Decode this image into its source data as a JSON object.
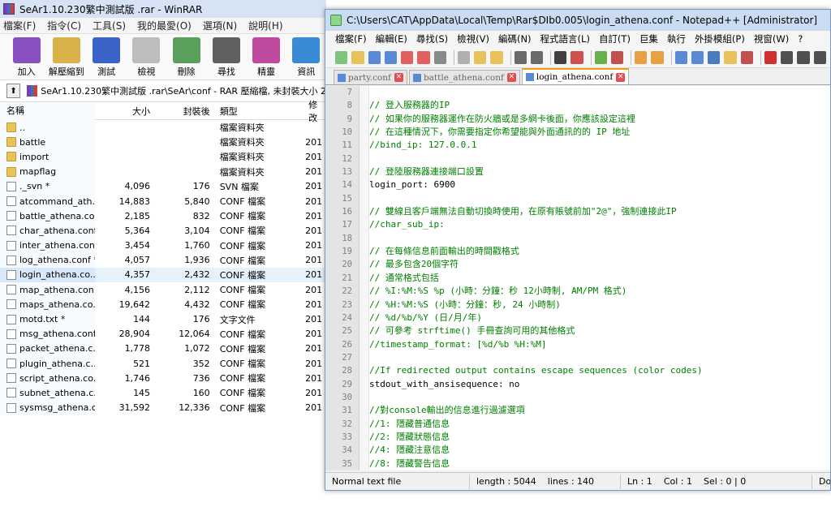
{
  "winrar": {
    "title": "SeAr1.10.230繁中測試版 .rar - WinRAR",
    "menu": [
      "檔案(F)",
      "指令(C)",
      "工具(S)",
      "我的最愛(O)",
      "選項(N)",
      "說明(H)"
    ],
    "toolbar": [
      {
        "label": "加入",
        "icon": "add-books-icon",
        "color": "#8a4fc0"
      },
      {
        "label": "解壓縮到",
        "icon": "extract-folder-icon",
        "color": "#d9b24a"
      },
      {
        "label": "測試",
        "icon": "test-book-icon",
        "color": "#3a62c8"
      },
      {
        "label": "檢視",
        "icon": "view-glasses-icon",
        "color": "#bdbdbd"
      },
      {
        "label": "刪除",
        "icon": "delete-bin-icon",
        "color": "#5aa05a"
      },
      {
        "label": "尋找",
        "icon": "find-binoculars-icon",
        "color": "#606060"
      },
      {
        "label": "精靈",
        "icon": "wizard-icon",
        "color": "#c04aa0"
      },
      {
        "label": "資訊",
        "icon": "info-icon",
        "color": "#3a8ad6"
      }
    ],
    "path": "SeAr1.10.230繁中測試版 .rar\\SeAr\\conf - RAR 壓縮檔, 未封裝大小 2",
    "columns": {
      "name": "名稱",
      "size": "大小",
      "packed": "封裝後",
      "type": "類型",
      "modified": "修改"
    },
    "files": [
      {
        "name": "..",
        "size": "",
        "packed": "",
        "type": "檔案資料夾",
        "mod": "",
        "kind": "folder"
      },
      {
        "name": "battle",
        "size": "",
        "packed": "",
        "type": "檔案資料夾",
        "mod": "201",
        "kind": "folder"
      },
      {
        "name": "import",
        "size": "",
        "packed": "",
        "type": "檔案資料夾",
        "mod": "201",
        "kind": "folder"
      },
      {
        "name": "mapflag",
        "size": "",
        "packed": "",
        "type": "檔案資料夾",
        "mod": "201",
        "kind": "folder"
      },
      {
        "name": "._svn *",
        "size": "4,096",
        "packed": "176",
        "type": "SVN 檔案",
        "mod": "201",
        "kind": "file"
      },
      {
        "name": "atcommand_ath...",
        "size": "14,883",
        "packed": "5,840",
        "type": "CONF 檔案",
        "mod": "201",
        "kind": "file"
      },
      {
        "name": "battle_athena.co...",
        "size": "2,185",
        "packed": "832",
        "type": "CONF 檔案",
        "mod": "201",
        "kind": "file"
      },
      {
        "name": "char_athena.conf *",
        "size": "5,364",
        "packed": "3,104",
        "type": "CONF 檔案",
        "mod": "201",
        "kind": "file"
      },
      {
        "name": "inter_athena.con...",
        "size": "3,454",
        "packed": "1,760",
        "type": "CONF 檔案",
        "mod": "201",
        "kind": "file"
      },
      {
        "name": "log_athena.conf *",
        "size": "4,057",
        "packed": "1,936",
        "type": "CONF 檔案",
        "mod": "201",
        "kind": "file"
      },
      {
        "name": "login_athena.co...",
        "size": "4,357",
        "packed": "2,432",
        "type": "CONF 檔案",
        "mod": "201",
        "kind": "file",
        "selected": true
      },
      {
        "name": "map_athena.con...",
        "size": "4,156",
        "packed": "2,112",
        "type": "CONF 檔案",
        "mod": "201",
        "kind": "file"
      },
      {
        "name": "maps_athena.co...",
        "size": "19,642",
        "packed": "4,432",
        "type": "CONF 檔案",
        "mod": "201",
        "kind": "file"
      },
      {
        "name": "motd.txt *",
        "size": "144",
        "packed": "176",
        "type": "文字文件",
        "mod": "201",
        "kind": "file"
      },
      {
        "name": "msg_athena.conf *",
        "size": "28,904",
        "packed": "12,064",
        "type": "CONF 檔案",
        "mod": "201",
        "kind": "file"
      },
      {
        "name": "packet_athena.c...",
        "size": "1,778",
        "packed": "1,072",
        "type": "CONF 檔案",
        "mod": "201",
        "kind": "file"
      },
      {
        "name": "plugin_athena.c...",
        "size": "521",
        "packed": "352",
        "type": "CONF 檔案",
        "mod": "201",
        "kind": "file"
      },
      {
        "name": "script_athena.co...",
        "size": "1,746",
        "packed": "736",
        "type": "CONF 檔案",
        "mod": "201",
        "kind": "file"
      },
      {
        "name": "subnet_athena.c...",
        "size": "145",
        "packed": "160",
        "type": "CONF 檔案",
        "mod": "201",
        "kind": "file"
      },
      {
        "name": "sysmsg_athena.c...",
        "size": "31,592",
        "packed": "12,336",
        "type": "CONF 檔案",
        "mod": "201",
        "kind": "file"
      }
    ]
  },
  "npp": {
    "title": "C:\\Users\\CAT\\AppData\\Local\\Temp\\Rar$DIb0.005\\login_athena.conf - Notepad++ [Administrator]",
    "menu": [
      "檔案(F)",
      "編輯(E)",
      "尋找(S)",
      "檢視(V)",
      "編碼(N)",
      "程式語言(L)",
      "自訂(T)",
      "巨集",
      "執行",
      "外掛模組(P)",
      "視窗(W)",
      "?"
    ],
    "toolbar_colors": [
      "#7dc47d",
      "#e8c25a",
      "#5a8ad6",
      "#5a8ad6",
      "#e06060",
      "#e06060",
      "#8a8a8a",
      "sep",
      "#b0b0b0",
      "#e8c25a",
      "#e8c25a",
      "sep",
      "#6a6a6a",
      "#6a6a6a",
      "sep",
      "#404040",
      "#d05050",
      "sep",
      "#6ab04a",
      "#c05050",
      "sep",
      "#e8a040",
      "#e8a040",
      "sep",
      "#5a8ad6",
      "#5a8ad6",
      "#4a7ac0",
      "#e8c25a",
      "#c05050",
      "sep",
      "#d03030",
      "#505050",
      "#505050",
      "#505050"
    ],
    "tabs": [
      {
        "label": "party.conf",
        "active": false
      },
      {
        "label": "battle_athena.conf",
        "active": false
      },
      {
        "label": "login_athena.conf",
        "active": true
      }
    ],
    "lines": [
      {
        "n": "7",
        "text": "",
        "kind": "plain"
      },
      {
        "n": "8",
        "text": "// 登入服務器的IP",
        "kind": "comment"
      },
      {
        "n": "9",
        "text": "// 如果你的服務器運作在防火牆或是多網卡後面，你應該設定這裡",
        "kind": "comment"
      },
      {
        "n": "10",
        "text": "// 在這種情況下，你需要指定你希望能與外面通訊的的 IP 地址",
        "kind": "comment"
      },
      {
        "n": "11",
        "text": "//bind_ip: 127.0.0.1",
        "kind": "comment"
      },
      {
        "n": "12",
        "text": "",
        "kind": "plain"
      },
      {
        "n": "13",
        "text": "// 登陸服務器連接端口設置",
        "kind": "comment"
      },
      {
        "n": "14",
        "text": "login_port: 6900",
        "kind": "plain"
      },
      {
        "n": "15",
        "text": "",
        "kind": "plain"
      },
      {
        "n": "16",
        "text": "// 雙線且客戶端無法自動切換時使用，在原有賬號前加\"2@\"，強制連接此IP",
        "kind": "comment"
      },
      {
        "n": "17",
        "text": "//char_sub_ip:",
        "kind": "comment"
      },
      {
        "n": "18",
        "text": "",
        "kind": "plain"
      },
      {
        "n": "19",
        "text": "// 在每條信息前面輸出的時間戳格式",
        "kind": "comment"
      },
      {
        "n": "20",
        "text": "// 最多包含20個字符",
        "kind": "comment"
      },
      {
        "n": "21",
        "text": "// 通常格式包括",
        "kind": "comment"
      },
      {
        "n": "22",
        "text": "// %I:%M:%S %p (小時：分鐘：秒 12小時制, AM/PM 格式)",
        "kind": "comment"
      },
      {
        "n": "23",
        "text": "// %H:%M:%S (小時：分鐘：秒, 24 小時制)",
        "kind": "comment"
      },
      {
        "n": "24",
        "text": "// %d/%b/%Y (日/月/年)",
        "kind": "comment"
      },
      {
        "n": "25",
        "text": "// 可參考 strftime() 手冊查詢可用的其他格式",
        "kind": "comment"
      },
      {
        "n": "26",
        "text": "//timestamp_format: [%d/%b %H:%M]",
        "kind": "comment"
      },
      {
        "n": "27",
        "text": "",
        "kind": "plain"
      },
      {
        "n": "28",
        "text": "//If redirected output contains escape sequences (color codes)",
        "kind": "comment"
      },
      {
        "n": "29",
        "text": "stdout_with_ansisequence: no",
        "kind": "plain"
      },
      {
        "n": "30",
        "text": "",
        "kind": "plain"
      },
      {
        "n": "31",
        "text": "//對console輸出的信息進行過濾選項",
        "kind": "comment"
      },
      {
        "n": "32",
        "text": "//1: 隱藏普通信息",
        "kind": "comment"
      },
      {
        "n": "33",
        "text": "//2: 隱藏狀態信息",
        "kind": "comment"
      },
      {
        "n": "34",
        "text": "//4: 隱藏注意信息",
        "kind": "comment"
      },
      {
        "n": "35",
        "text": "//8: 隱藏警告信息",
        "kind": "comment"
      }
    ],
    "status": {
      "type": "Normal text file",
      "length": "length : 5044",
      "lines": "lines : 140",
      "ln": "Ln : 1",
      "col": "Col : 1",
      "sel": "Sel : 0 | 0",
      "eol": "Do"
    }
  }
}
